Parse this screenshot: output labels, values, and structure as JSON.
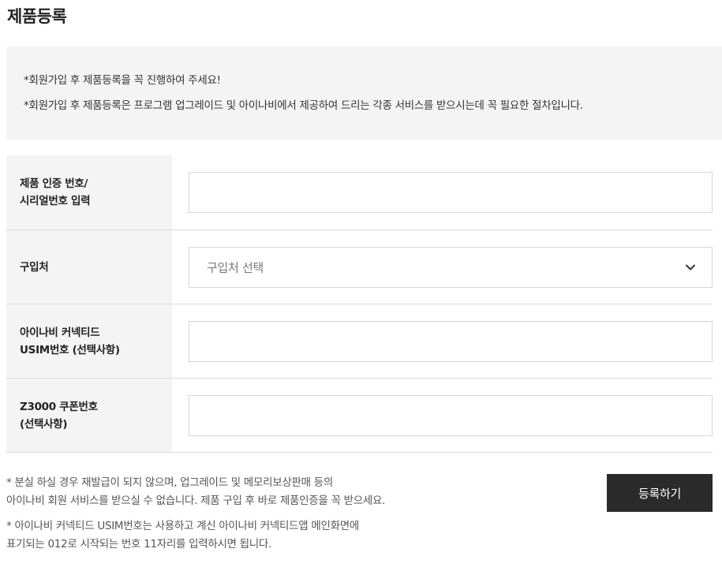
{
  "page": {
    "title": "제품등록"
  },
  "notice": {
    "line1": "*회원가입 후 제품등록을 꼭 진행하여 주세요!",
    "line2": "*회원가입 후 제품등록은 프로그램 업그레이드 및 아이나비에서 제공하여 드리는 각종 서비스를 받으시는데 꼭 필요한 절차입니다."
  },
  "form": {
    "rows": [
      {
        "label_line1": "제품 인증 번호/",
        "label_line2": "시리얼번호 입력",
        "value": ""
      },
      {
        "label_line1": "구입처",
        "select_placeholder": "구입처 선택",
        "select_icon": "chevron-down-icon"
      },
      {
        "label_line1": "아이나비 커넥티드",
        "label_line2": "USIM번호 (선택사항)",
        "value": ""
      },
      {
        "label_line1": "Z3000 쿠폰번호",
        "label_line2": "(선택사항)",
        "value": ""
      }
    ]
  },
  "notes": {
    "note1_line1": "* 분실 하실 경우 재발급이 되지 않으며, 업그레이드 및 메모리보상판매 등의",
    "note1_line2": "아이나비 회원 서비스를 받으실 수 없습니다. 제품 구입 후 바로 제품인증을 꼭 받으세요.",
    "note2_line1": "* 아이나비 커넥티드 USIM번호는 사용하고 계신 아이나비 커넥티드앱 메인화면에",
    "note2_line2": "표기되는 012로 시작되는 번호 11자리를 입력하시면 됩니다."
  },
  "actions": {
    "submit_label": "등록하기"
  },
  "colors": {
    "panel_background": "#f4f4f4",
    "button_background": "#2b2b2b",
    "button_text": "#ffffff"
  }
}
